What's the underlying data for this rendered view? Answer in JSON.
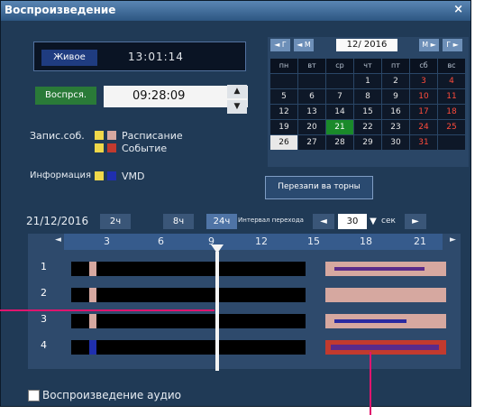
{
  "window": {
    "title": "Воспроизведение",
    "close_label": "×"
  },
  "live": {
    "label": "Живое",
    "time": "13:01:14"
  },
  "playback": {
    "label": "Воспрся.",
    "time": "09:28:09",
    "up": "▲",
    "down": "▼"
  },
  "legend": {
    "rec_label": "Запис.соб.",
    "schedule_label": "Расписание",
    "event_label": "Событие",
    "info_label": "Информация",
    "vmd_label": "VMD",
    "colors": {
      "schedule": "#d6a8a0",
      "event": "#c23a2e",
      "vmd": "#1f2fae",
      "info": "#f0d84a"
    }
  },
  "calendar": {
    "nav": [
      "◄ Г",
      "◄ М",
      "М ►",
      "Г ►"
    ],
    "month": "12/ 2016",
    "weekdays": [
      "пн",
      "вт",
      "ср",
      "чт",
      "пт",
      "сб",
      "вс"
    ],
    "weeks": [
      [
        "",
        "",
        "",
        "1",
        "2",
        "3",
        "4"
      ],
      [
        "5",
        "6",
        "7",
        "8",
        "9",
        "10",
        "11"
      ],
      [
        "12",
        "13",
        "14",
        "15",
        "16",
        "17",
        "18"
      ],
      [
        "19",
        "20",
        "21",
        "22",
        "23",
        "24",
        "25"
      ],
      [
        "26",
        "27",
        "28",
        "29",
        "30",
        "31",
        ""
      ]
    ],
    "today": "21",
    "selected": "26"
  },
  "export_button": "Перезапи ва торны",
  "timebar": {
    "date": "21/12/2016",
    "ranges": [
      "2ч",
      "8ч",
      "24ч"
    ],
    "active_range": "24ч",
    "interval_label": "Интервал перехода",
    "interval_value": "30",
    "interval_unit": "сек"
  },
  "timeline": {
    "hours": [
      "3",
      "6",
      "9",
      "12",
      "15",
      "18",
      "21"
    ],
    "channels": [
      "1",
      "2",
      "3",
      "4"
    ]
  },
  "audio": {
    "label": "Воспроизведение аудио"
  }
}
